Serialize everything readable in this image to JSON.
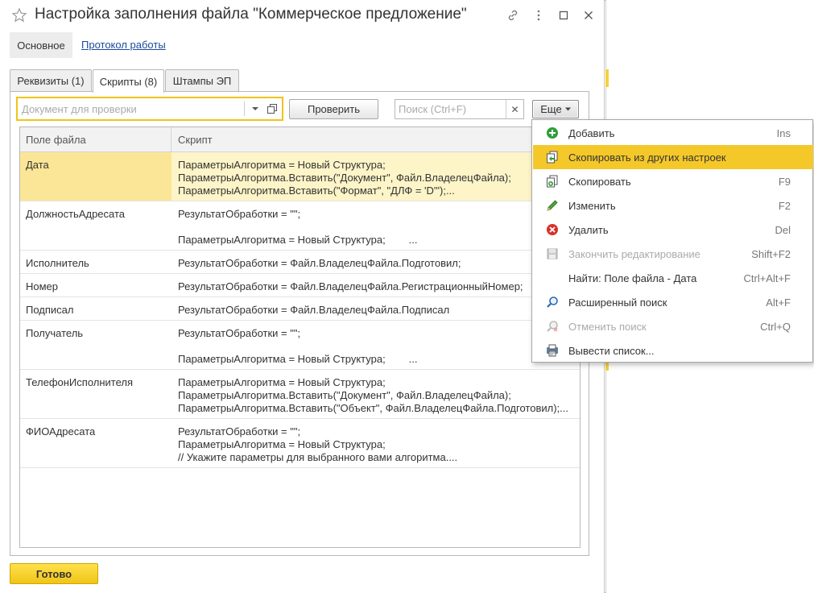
{
  "window": {
    "title": "Настройка заполнения файла \"Коммерческое предложение\""
  },
  "top_tabs": {
    "main": "Основное",
    "log": "Протокол работы"
  },
  "tabs": [
    {
      "label": "Реквизиты (1)"
    },
    {
      "label": "Скрипты (8)"
    },
    {
      "label": "Штампы ЭП"
    }
  ],
  "toolbar": {
    "doc_placeholder": "Документ для проверки",
    "check_label": "Проверить",
    "search_placeholder": "Поиск (Ctrl+F)",
    "more_label": "Еще"
  },
  "grid": {
    "columns": [
      "Поле файла",
      "Скрипт"
    ],
    "rows": [
      {
        "field": "Дата",
        "script": "ПараметрыАлгоритма = Новый Структура;\nПараметрыАлгоритма.Вставить(\"Документ\", Файл.ВладелецФайла);\nПараметрыАлгоритма.Вставить(\"Формат\", \"ДЛФ = 'D'\");..."
      },
      {
        "field": "ДолжностьАдресата",
        "script": "РезультатОбработки = \"\";\n\nПараметрыАлгоритма = Новый Структура;        ..."
      },
      {
        "field": "Исполнитель",
        "script": "РезультатОбработки = Файл.ВладелецФайла.Подготовил;"
      },
      {
        "field": "Номер",
        "script": "РезультатОбработки = Файл.ВладелецФайла.РегистрационныйНомер;"
      },
      {
        "field": "Подписал",
        "script": "РезультатОбработки = Файл.ВладелецФайла.Подписал"
      },
      {
        "field": "Получатель",
        "script": "РезультатОбработки = \"\";\n\nПараметрыАлгоритма = Новый Структура;        ..."
      },
      {
        "field": "ТелефонИсполнителя",
        "script": "ПараметрыАлгоритма = Новый Структура;\nПараметрыАлгоритма.Вставить(\"Документ\", Файл.ВладелецФайла);\nПараметрыАлгоритма.Вставить(\"Объект\", Файл.ВладелецФайла.Подготовил);..."
      },
      {
        "field": "ФИОАдресата",
        "script": "РезультатОбработки = \"\";\nПараметрыАлгоритма = Новый Структура;\n// Укажите параметры для выбранного вами алгоритма...."
      }
    ]
  },
  "footer": {
    "done_label": "Готово"
  },
  "menu": {
    "items": [
      {
        "label": "Добавить",
        "shortcut": "Ins",
        "icon": "add-icon"
      },
      {
        "label": "Скопировать из других настроек",
        "shortcut": "",
        "icon": "copy-from-icon"
      },
      {
        "label": "Скопировать",
        "shortcut": "F9",
        "icon": "copy-icon"
      },
      {
        "label": "Изменить",
        "shortcut": "F2",
        "icon": "pencil-icon"
      },
      {
        "label": "Удалить",
        "shortcut": "Del",
        "icon": "delete-icon"
      },
      {
        "label": "Закончить редактирование",
        "shortcut": "Shift+F2",
        "icon": "finish-edit-icon"
      },
      {
        "label": "Найти: Поле файла - Дата",
        "shortcut": "Ctrl+Alt+F",
        "icon": ""
      },
      {
        "label": "Расширенный поиск",
        "shortcut": "Alt+F",
        "icon": "search-icon"
      },
      {
        "label": "Отменить поиск",
        "shortcut": "Ctrl+Q",
        "icon": "cancel-search-icon"
      },
      {
        "label": "Вывести список...",
        "shortcut": "",
        "icon": "print-list-icon"
      }
    ]
  },
  "colors": {
    "accent": "#f5c82a",
    "selected_row": "#fdf4c8",
    "link": "#1a4a9e"
  }
}
